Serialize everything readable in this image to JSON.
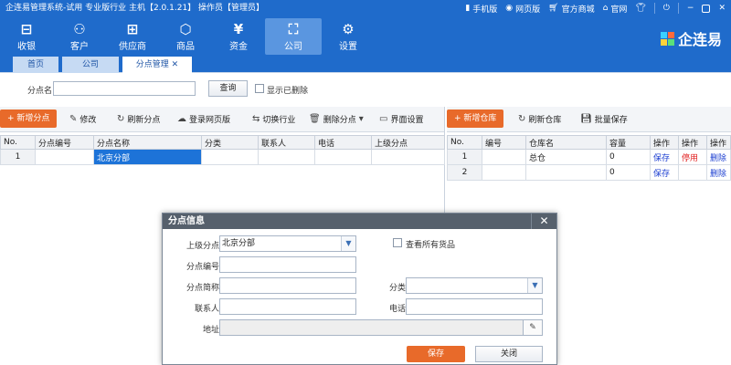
{
  "app": {
    "title": "企连易管理系统-试用 专业版行业 主机【2.0.1.21】 操作员【管理员】",
    "top_links": [
      "手机版",
      "网页版",
      "官方商城",
      "官网"
    ],
    "logo_text": "企连易"
  },
  "nav": [
    {
      "label": "收银",
      "icon": "cashier-icon"
    },
    {
      "label": "客户",
      "icon": "customer-icon"
    },
    {
      "label": "供应商",
      "icon": "supplier-icon"
    },
    {
      "label": "商品",
      "icon": "goods-icon"
    },
    {
      "label": "资金",
      "icon": "money-icon"
    },
    {
      "label": "公司",
      "icon": "company-icon",
      "active": true
    },
    {
      "label": "设置",
      "icon": "settings-icon"
    }
  ],
  "tabs": [
    "首页",
    "公司",
    "分点管理"
  ],
  "filter": {
    "label": "分点名",
    "value": "",
    "query_btn": "查询",
    "show_deleted": "显示已删除"
  },
  "left_toolbar": {
    "add": "+ 新增分点",
    "edit": "修改",
    "refresh": "刷新分点",
    "web": "登录网页版",
    "switch": "切换行业",
    "delete": "删除分点",
    "ui": "界面设置"
  },
  "left_table": {
    "headers": [
      "No.",
      "分点编号",
      "分点名称",
      "分类",
      "联系人",
      "电话",
      "上级分点"
    ],
    "rows": [
      [
        "1",
        "",
        "北京分部",
        "",
        "",
        "",
        ""
      ]
    ]
  },
  "right_toolbar": {
    "add": "+ 新增仓库",
    "refresh": "刷新仓库",
    "batch_save": "批量保存"
  },
  "right_table": {
    "headers": [
      "No.",
      "编号",
      "仓库名",
      "容量",
      "操作",
      "操作",
      "操作"
    ],
    "rows": [
      [
        "1",
        "",
        "总仓",
        "0",
        "保存",
        "停用",
        "删除"
      ],
      [
        "2",
        "",
        "",
        "0",
        "保存",
        "",
        "删除"
      ]
    ]
  },
  "dialog": {
    "title": "分点信息",
    "parent_label": "上级分点",
    "parent_value": "北京分部",
    "view_all": "查看所有货品",
    "code_label": "分点编号",
    "code_value": "",
    "short_label": "分点简称",
    "short_value": "",
    "category_label": "分类",
    "category_value": "",
    "contact_label": "联系人",
    "contact_value": "",
    "phone_label": "电话",
    "phone_value": "",
    "address_label": "地址",
    "address_value": "",
    "save": "保存",
    "close": "关闭"
  },
  "colors": {
    "brand_blue": "#1f6bcb",
    "accent_orange": "#e86a2a",
    "selection_blue": "#1d73d8",
    "link_blue": "#1c3fd1",
    "danger_red": "#e02020"
  }
}
